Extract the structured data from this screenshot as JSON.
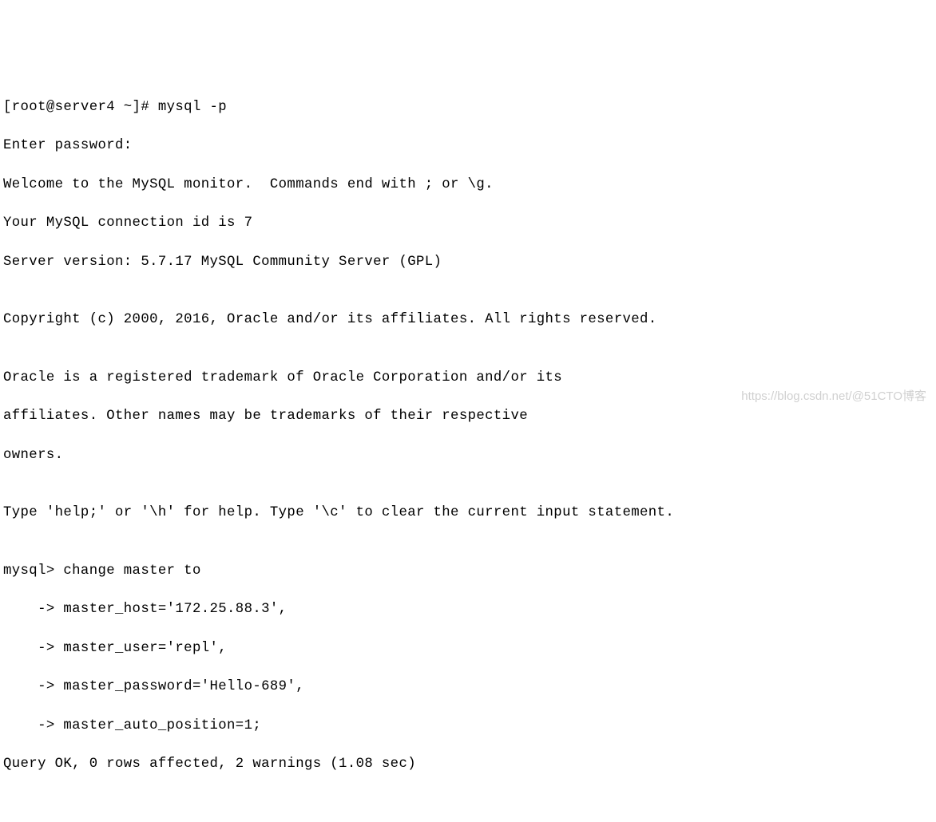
{
  "terminal": {
    "lines": [
      "[root@server4 ~]# mysql -p",
      "Enter password:",
      "Welcome to the MySQL monitor.  Commands end with ; or \\g.",
      "Your MySQL connection id is 7",
      "Server version: 5.7.17 MySQL Community Server (GPL)",
      "",
      "Copyright (c) 2000, 2016, Oracle and/or its affiliates. All rights reserved.",
      "",
      "Oracle is a registered trademark of Oracle Corporation and/or its",
      "affiliates. Other names may be trademarks of their respective",
      "owners.",
      "",
      "Type 'help;' or '\\h' for help. Type '\\c' to clear the current input statement.",
      "",
      "mysql> change master to",
      "    -> master_host='172.25.88.3',",
      "    -> master_user='repl',",
      "    -> master_password='Hello-689',",
      "    -> master_auto_position=1;",
      "Query OK, 0 rows affected, 2 warnings (1.08 sec)"
    ]
  },
  "watermark": "https://blog.csdn.net/@51CTO博客"
}
